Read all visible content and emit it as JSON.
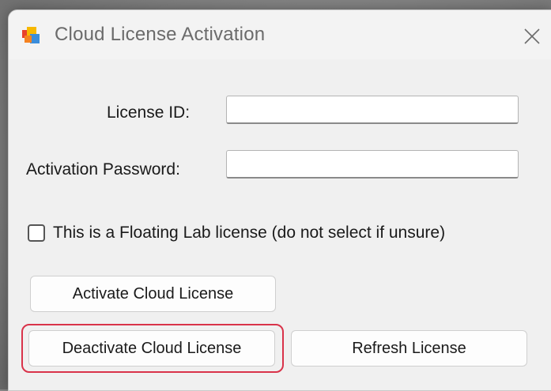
{
  "window": {
    "title": "Cloud License Activation",
    "app_icon": "windows-form-icon",
    "close_icon": "close-icon"
  },
  "form": {
    "license_id_label": "License ID:",
    "license_id_value": "",
    "activation_password_label": "Activation Password:",
    "activation_password_value": "",
    "floating_lab_checkbox_label": "This is a Floating Lab license (do not select if unsure)",
    "floating_lab_checked": false
  },
  "buttons": {
    "activate": "Activate Cloud License",
    "deactivate": "Deactivate Cloud License",
    "refresh": "Refresh License"
  },
  "colors": {
    "highlight": "#d9334a",
    "window_bg": "#f0f0f0"
  }
}
